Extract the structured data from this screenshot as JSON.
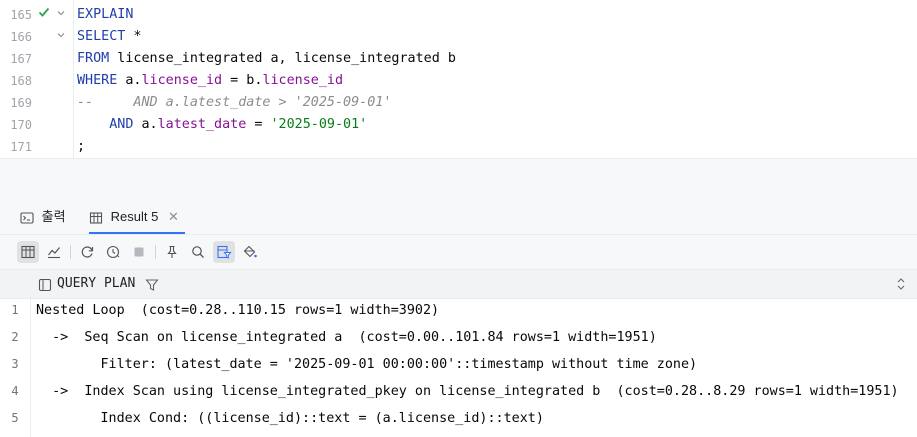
{
  "editor": {
    "lines": [
      {
        "num": "165",
        "parts": [
          {
            "t": "EXPLAIN",
            "c": "kw"
          }
        ]
      },
      {
        "num": "166",
        "parts": [
          {
            "t": "SELECT",
            "c": "kw"
          },
          {
            "t": " *",
            "c": ""
          }
        ]
      },
      {
        "num": "167",
        "parts": [
          {
            "t": "FROM",
            "c": "kw"
          },
          {
            "t": " license_integrated a, license_integrated b",
            "c": ""
          }
        ]
      },
      {
        "num": "168",
        "parts": [
          {
            "t": "WHERE",
            "c": "kw"
          },
          {
            "t": " a.",
            "c": ""
          },
          {
            "t": "license_id",
            "c": "col"
          },
          {
            "t": " = b.",
            "c": ""
          },
          {
            "t": "license_id",
            "c": "col"
          }
        ]
      },
      {
        "num": "169",
        "parts": [
          {
            "t": "--     AND a.latest_date > '2025-09-01'",
            "c": "cm"
          }
        ]
      },
      {
        "num": "170",
        "parts": [
          {
            "t": "    ",
            "c": ""
          },
          {
            "t": "AND",
            "c": "kw"
          },
          {
            "t": " a.",
            "c": ""
          },
          {
            "t": "latest_date",
            "c": "col"
          },
          {
            "t": " = ",
            "c": ""
          },
          {
            "t": "'2025-09-01'",
            "c": "str"
          }
        ]
      },
      {
        "num": "171",
        "parts": [
          {
            "t": ";",
            "c": ""
          }
        ]
      }
    ]
  },
  "tabs": {
    "output_label": "출력",
    "result_label": "Result 5"
  },
  "header": {
    "column": "QUERY PLAN"
  },
  "rows": [
    {
      "num": "1",
      "text": "Nested Loop  (cost=0.28..110.15 rows=1 width=3902)"
    },
    {
      "num": "2",
      "text": "  ->  Seq Scan on license_integrated a  (cost=0.00..101.84 rows=1 width=1951)"
    },
    {
      "num": "3",
      "text": "        Filter: (latest_date = '2025-09-01 00:00:00'::timestamp without time zone)"
    },
    {
      "num": "4",
      "text": "  ->  Index Scan using license_integrated_pkey on license_integrated b  (cost=0.28..8.29 rows=1 width=1951)"
    },
    {
      "num": "5",
      "text": "        Index Cond: ((license_id)::text = (a.license_id)::text)"
    }
  ],
  "colors": {
    "accent": "#3574f0",
    "keyword": "#1f3fa8",
    "column": "#871094",
    "string": "#067d17",
    "comment": "#8c8c8c",
    "check": "#2da44e"
  }
}
